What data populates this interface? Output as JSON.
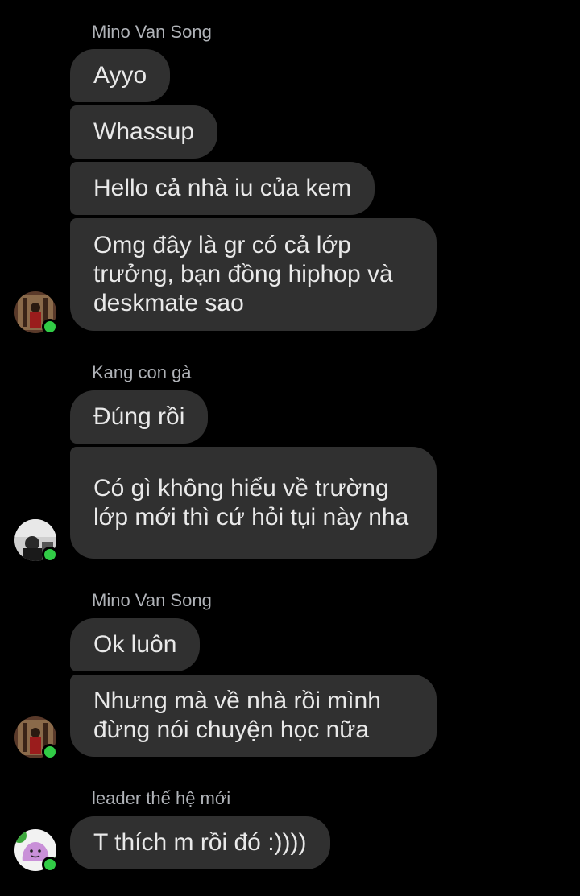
{
  "colors": {
    "background": "#000000",
    "bubble": "#303030",
    "bubble_text": "#e9e9e9",
    "sender_text": "#b0b3b8",
    "online": "#31cc46"
  },
  "groups": [
    {
      "sender": "Mino Van Song",
      "avatar_icon": "user-avatar-photo-icon",
      "messages": [
        "Ayyo",
        "Whassup",
        "Hello cả nhà iu của kem",
        "Omg đây là gr có cả lớp trưởng, bạn đồng hiphop và deskmate sao"
      ]
    },
    {
      "sender": "Kang con gà",
      "avatar_icon": "user-avatar-photo-icon",
      "messages": [
        "Đúng rồi",
        "Có gì không hiểu về trường lớp mới thì cứ hỏi tụi này nha"
      ]
    },
    {
      "sender": "Mino Van Song",
      "avatar_icon": "user-avatar-photo-icon",
      "messages": [
        "Ok luôn",
        "Nhưng mà về nhà rồi mình đừng nói chuyện học nữa"
      ]
    },
    {
      "sender": "leader thế hệ mới",
      "avatar_icon": "ditto-avatar-icon",
      "messages": [
        "T thích m rồi đó :))))"
      ]
    }
  ]
}
